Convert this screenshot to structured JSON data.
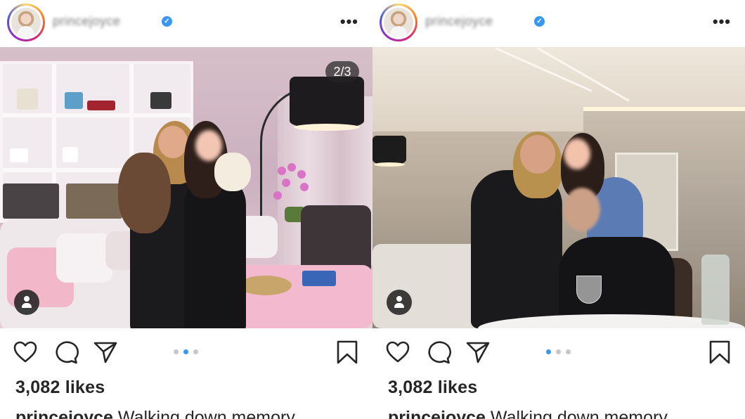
{
  "posts": [
    {
      "username": "princejoyce",
      "counter": "2/3",
      "likes": "3,082 likes",
      "caption_user": "princejoyce",
      "caption_text": " Walking down memory",
      "carousel_active_index": 1,
      "carousel_count": 3
    },
    {
      "username": "princejoyce",
      "likes": "3,082 likes",
      "caption_user": "princejoyce",
      "caption_text": " Walking down memory",
      "carousel_active_index": 0,
      "carousel_count": 3
    }
  ],
  "header": {
    "more_label": "•••",
    "verified_mark": "✓"
  },
  "icons": {
    "like": "heart-icon",
    "comment": "comment-icon",
    "share": "send-icon",
    "save": "bookmark-icon",
    "more": "more-icon",
    "tagged_user": "user-tag-icon",
    "verified": "verified-badge-icon"
  },
  "colors": {
    "text": "#262626",
    "verified": "#3897f0",
    "carousel_active": "#3897f0",
    "carousel_inactive": "#c7c7c7"
  }
}
